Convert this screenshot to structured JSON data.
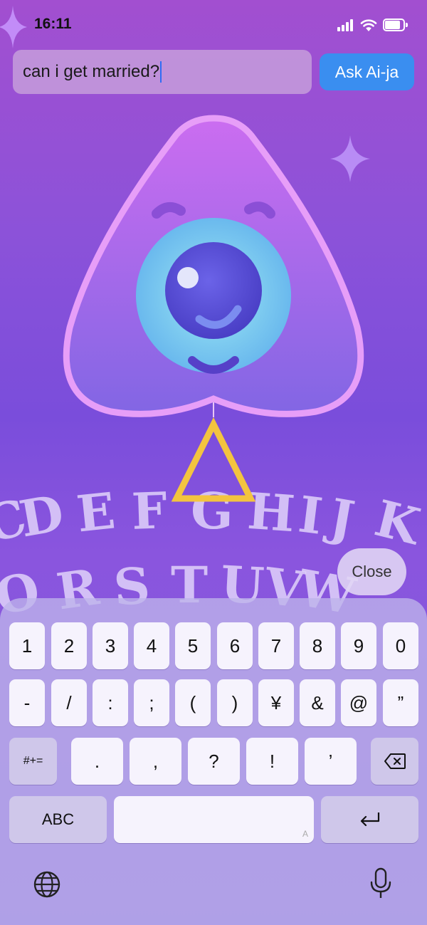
{
  "status_bar": {
    "time": "16:11"
  },
  "question": {
    "value": "can i get married?"
  },
  "ask_button": {
    "label": "Ask Ai-ja"
  },
  "board": {
    "row1": [
      "D",
      "E",
      "F",
      "G",
      "H",
      "I",
      "J",
      "K"
    ],
    "row2": [
      "O",
      "R",
      "S",
      "T",
      "U",
      "V",
      "W"
    ]
  },
  "close_button": {
    "label": "Close"
  },
  "keyboard": {
    "row1": [
      "1",
      "2",
      "3",
      "4",
      "5",
      "6",
      "7",
      "8",
      "9",
      "0"
    ],
    "row2": [
      "-",
      "/",
      ":",
      ";",
      "(",
      ")",
      "¥",
      "&",
      "@",
      "”"
    ],
    "row3": [
      ".",
      ",",
      "?",
      "!",
      "’"
    ],
    "symbols_key": "#+=",
    "abc_key": "ABC",
    "space_hint": "A"
  },
  "icons": {
    "globe": "globe-icon",
    "mic": "microphone-icon",
    "delete": "backspace-icon",
    "return": "return-icon"
  },
  "colors": {
    "accent": "#3a8ef0",
    "triangle": "#f3c43f"
  }
}
